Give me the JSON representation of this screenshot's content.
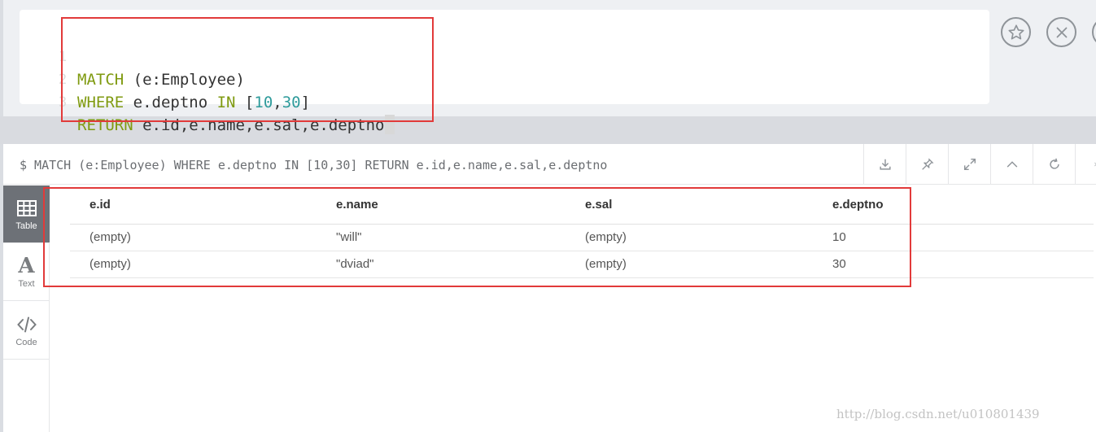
{
  "editor": {
    "lines": [
      {
        "num": "1",
        "tokens": [
          {
            "t": "MATCH",
            "k": "kw"
          },
          {
            "t": " (e:Employee)",
            "k": ""
          }
        ]
      },
      {
        "num": "2",
        "tokens": [
          {
            "t": "WHERE",
            "k": "kw"
          },
          {
            "t": " e.deptno ",
            "k": ""
          },
          {
            "t": "IN",
            "k": "kw"
          },
          {
            "t": " [",
            "k": ""
          },
          {
            "t": "10",
            "k": "num"
          },
          {
            "t": ",",
            "k": ""
          },
          {
            "t": "30",
            "k": "num"
          },
          {
            "t": "]",
            "k": ""
          }
        ]
      },
      {
        "num": "3",
        "tokens": [
          {
            "t": "RETURN",
            "k": "kw"
          },
          {
            "t": " e.id,e.name,e.sal,e.deptno",
            "k": ""
          }
        ]
      }
    ],
    "actions": [
      "star-icon",
      "close-circle-icon",
      "play-icon"
    ]
  },
  "result": {
    "query": "$ MATCH (e:Employee) WHERE e.deptno IN [10,30] RETURN e.id,e.name,e.sal,e.deptno",
    "header_icons": [
      "download-icon",
      "pin-icon",
      "expand-icon",
      "collapse-icon",
      "rerun-icon",
      "close-icon"
    ],
    "tabs": [
      {
        "label": "Table",
        "icon": "table-icon",
        "active": true
      },
      {
        "label": "Text",
        "icon": "text-icon",
        "active": false
      },
      {
        "label": "Code",
        "icon": "code-icon",
        "active": false
      }
    ],
    "columns": [
      "e.id",
      "e.name",
      "e.sal",
      "e.deptno"
    ],
    "rows": [
      [
        "(empty)",
        "\"will\"",
        "(empty)",
        "10"
      ],
      [
        "(empty)",
        "\"dviad\"",
        "(empty)",
        "30"
      ]
    ]
  },
  "watermark": "http://blog.csdn.net/u010801439",
  "colors": {
    "keyword": "#7f9a10",
    "number": "#2e9b9b",
    "highlight": "#e23a3a",
    "active_tab": "#6d7177"
  }
}
